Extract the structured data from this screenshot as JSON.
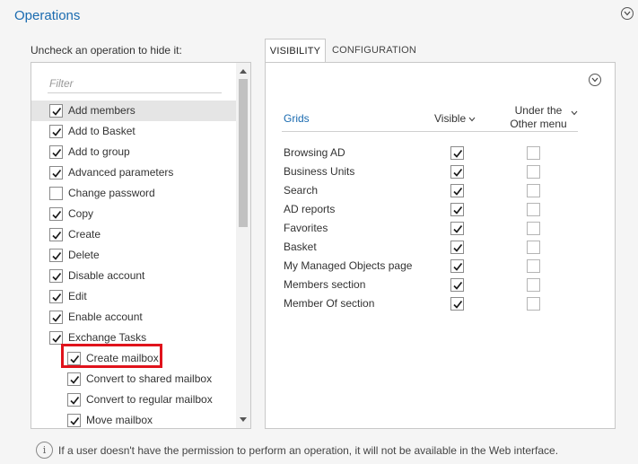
{
  "section": {
    "title": "Operations",
    "collapse_icon": "chevron-circle-icon"
  },
  "hint": "Uncheck an operation to hide it:",
  "filter": {
    "placeholder": "Filter",
    "value": ""
  },
  "operations": [
    {
      "label": "Add members",
      "checked": true,
      "child": false,
      "selected": true
    },
    {
      "label": "Add to Basket",
      "checked": true,
      "child": false
    },
    {
      "label": "Add to group",
      "checked": true,
      "child": false
    },
    {
      "label": "Advanced parameters",
      "checked": true,
      "child": false
    },
    {
      "label": "Change password",
      "checked": false,
      "child": false
    },
    {
      "label": "Copy",
      "checked": true,
      "child": false
    },
    {
      "label": "Create",
      "checked": true,
      "child": false
    },
    {
      "label": "Delete",
      "checked": true,
      "child": false
    },
    {
      "label": "Disable account",
      "checked": true,
      "child": false
    },
    {
      "label": "Edit",
      "checked": true,
      "child": false
    },
    {
      "label": "Enable account",
      "checked": true,
      "child": false
    },
    {
      "label": "Exchange Tasks",
      "checked": true,
      "child": false
    },
    {
      "label": "Create mailbox",
      "checked": true,
      "child": true,
      "highlighted": true
    },
    {
      "label": "Convert to shared mailbox",
      "checked": true,
      "child": true
    },
    {
      "label": "Convert to regular mailbox",
      "checked": true,
      "child": true
    },
    {
      "label": "Move mailbox",
      "checked": true,
      "child": true
    }
  ],
  "tabs": [
    {
      "label": "VISIBILITY",
      "active": true
    },
    {
      "label": "CONFIGURATION",
      "active": false
    }
  ],
  "grid_columns": {
    "grids": "Grids",
    "visible": "Visible",
    "other_line1": "Under the",
    "other_line2": "Other menu"
  },
  "grid_rows": [
    {
      "name": "Browsing AD",
      "visible": true,
      "other": false
    },
    {
      "name": "Business Units",
      "visible": true,
      "other": false
    },
    {
      "name": "Search",
      "visible": true,
      "other": false
    },
    {
      "name": "AD reports",
      "visible": true,
      "other": false
    },
    {
      "name": "Favorites",
      "visible": true,
      "other": false
    },
    {
      "name": "Basket",
      "visible": true,
      "other": false
    },
    {
      "name": "My Managed Objects page",
      "visible": true,
      "other": false
    },
    {
      "name": "Members section",
      "visible": true,
      "other": false
    },
    {
      "name": "Member Of section",
      "visible": true,
      "other": false
    }
  ],
  "info": "If a user doesn't have the permission to perform an operation, it will not be available in the Web interface.",
  "colors": {
    "accent": "#1a6bb0",
    "highlight": "#e0131c"
  }
}
